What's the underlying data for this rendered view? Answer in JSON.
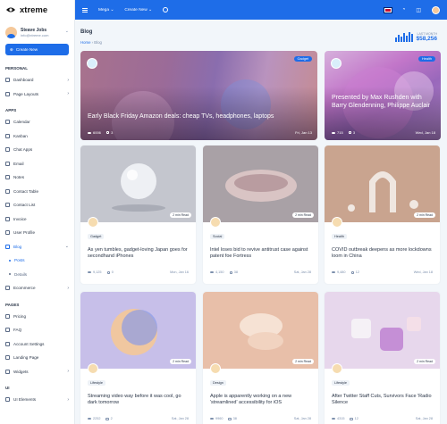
{
  "brand": {
    "name": "xtreme"
  },
  "user": {
    "name": "Steave Jobs",
    "email": "info@xtreme.com"
  },
  "sidebar": {
    "create_label": "Create New",
    "sections": [
      {
        "caption": "PERSONAL",
        "items": [
          {
            "label": "Dashboard",
            "arrow": true
          },
          {
            "label": "Page Layouts",
            "arrow": true
          }
        ]
      },
      {
        "caption": "APPS",
        "items": [
          {
            "label": "Calendar"
          },
          {
            "label": "Kanban"
          },
          {
            "label": "Chat Apps"
          },
          {
            "label": "Email"
          },
          {
            "label": "Notes"
          },
          {
            "label": "Contact Table"
          },
          {
            "label": "Contact List"
          },
          {
            "label": "Invoice"
          },
          {
            "label": "User Profile"
          },
          {
            "label": "Blog",
            "arrow": true,
            "active": true
          },
          {
            "label": "Posts",
            "sub": true,
            "active": true
          },
          {
            "label": "Details",
            "sub": true
          },
          {
            "label": "Ecommerce",
            "arrow": true
          }
        ]
      },
      {
        "caption": "PAGES",
        "items": [
          {
            "label": "Pricing"
          },
          {
            "label": "FAQ"
          },
          {
            "label": "Account Settings"
          },
          {
            "label": "Landing Page"
          },
          {
            "label": "Widgets",
            "arrow": true
          }
        ]
      },
      {
        "caption": "UI",
        "items": [
          {
            "label": "UI Elements",
            "arrow": true
          }
        ]
      }
    ]
  },
  "topbar": {
    "links": [
      "Mega ⌄",
      "Create New ⌄"
    ]
  },
  "page": {
    "title": "Blog",
    "breadcrumb": [
      "Home",
      "Blog"
    ],
    "stat_label": "LAST MONTH",
    "stat_value": "$58,256"
  },
  "featured": [
    {
      "title": "Early Black Friday Amazon deals: cheap TVs, headphones, laptops",
      "badge": "Gadget",
      "views": "6006",
      "comments": "3",
      "date": "Fri, Jan 13"
    },
    {
      "title": "Presented by Max Rushden with Barry Glendenning, Philippe Auclair",
      "badge": "Health",
      "views": "715",
      "comments": "3",
      "date": "Wed, Jan 18"
    }
  ],
  "posts": [
    {
      "read": "2 min Read",
      "tag": "Gadget",
      "title": "As yen tumbles, gadget-loving Japan goes for secondhand iPhones",
      "views": "9,125",
      "comments": "0",
      "date": "Mon, Jan 16"
    },
    {
      "read": "2 min Read",
      "tag": "Social",
      "title": "Intel loses bid to revive antitrust case against patent foe Fortress",
      "views": "4,150",
      "comments": "38",
      "date": "Sat, Jan 28"
    },
    {
      "read": "2 min Read",
      "tag": "Health",
      "title": "COVID outbreak deepens as more lockdowns loom in China",
      "views": "9,480",
      "comments": "12",
      "date": "Wed, Jan 18"
    },
    {
      "read": "2 min Read",
      "tag": "Lifestyle",
      "title": "Streaming video way before it was cool, go dark tomorrow",
      "views": "2252",
      "comments": "2",
      "date": "Sat, Jan 28"
    },
    {
      "read": "2 min Read",
      "tag": "Design",
      "title": "Apple is apparently working on a new 'streamlined' accessibility for iOS",
      "views": "9960",
      "comments": "38",
      "date": "Sat, Jan 28"
    },
    {
      "read": "2 min Read",
      "tag": "Lifestyle",
      "title": "After Twitter Staff Cuts, Survivors Face 'Radio Silence",
      "views": "4315",
      "comments": "12",
      "date": "Sat, Jan 28"
    }
  ]
}
